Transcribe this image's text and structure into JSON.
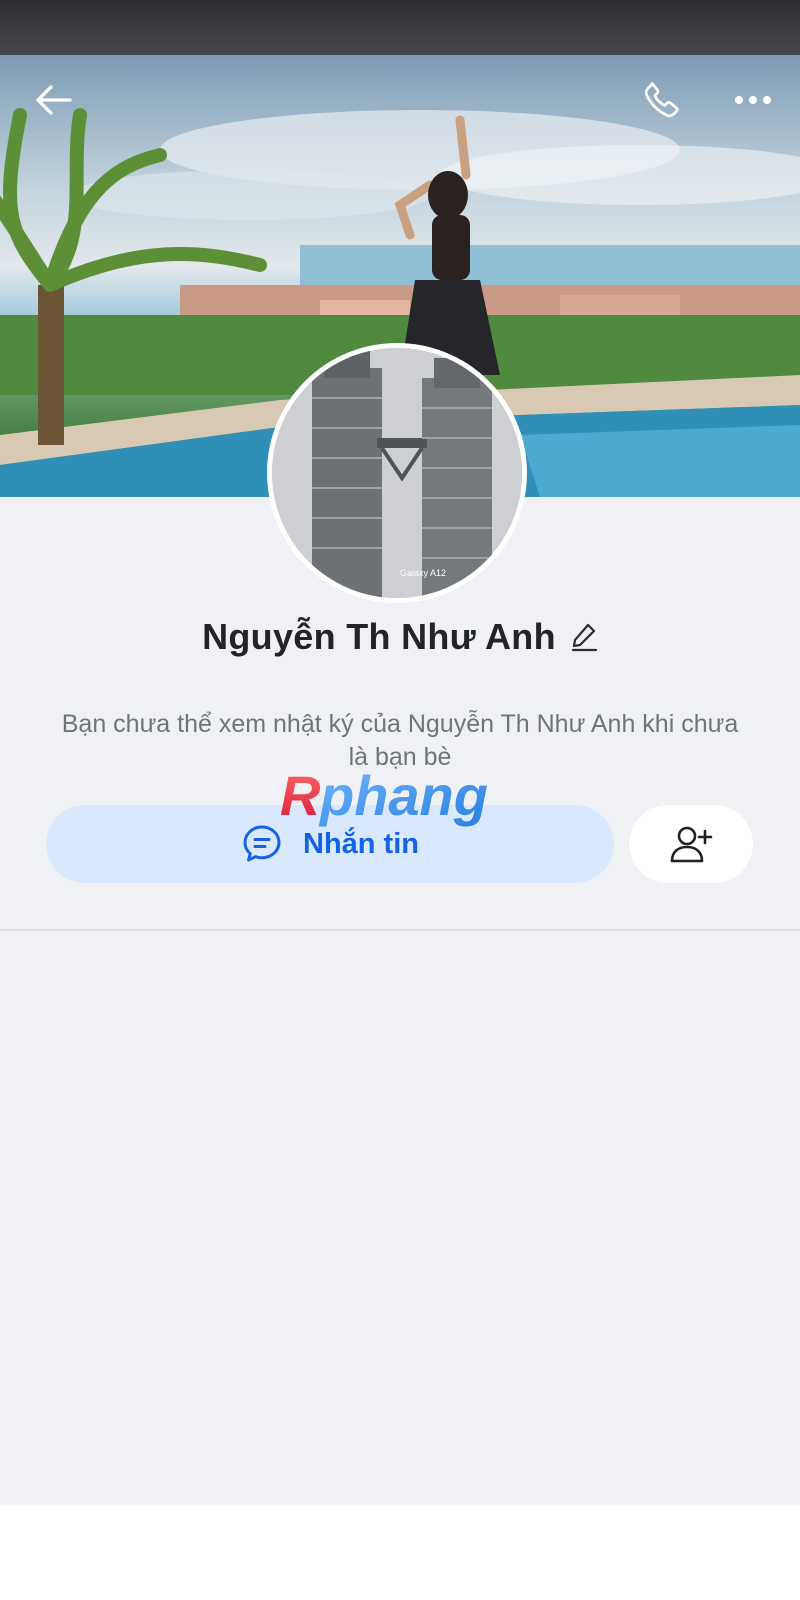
{
  "profile": {
    "name": "Nguyễn Th Như Anh",
    "info_message": "Bạn chưa thể xem nhật ký của Nguyễn Th Như Anh khi chưa là bạn bè",
    "avatar_caption": "Galaxy A12"
  },
  "actions": {
    "message_label": "Nhắn tin"
  },
  "watermark": {
    "text": "Rphang"
  },
  "icons": {
    "back": "arrow-left",
    "call": "phone",
    "more": "ellipsis-horizontal",
    "edit": "pencil",
    "message": "chat-bubble",
    "add_friend": "user-plus"
  },
  "colors": {
    "accent": "#1463e6",
    "message_button_bg": "#d9e8fd",
    "page_bg": "#f0f1f5"
  }
}
